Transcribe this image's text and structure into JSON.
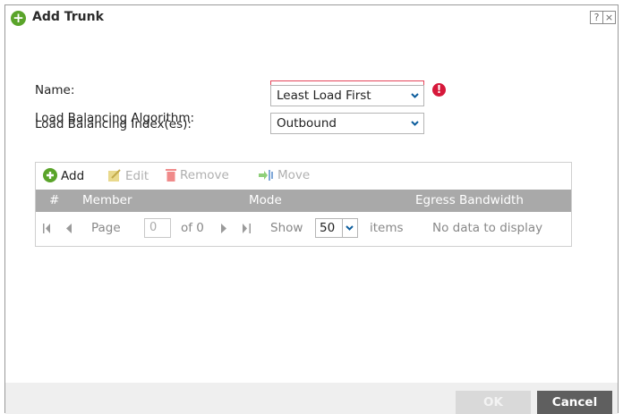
{
  "dialog": {
    "title": "Add Trunk",
    "help_label": "?",
    "close_label": "×"
  },
  "form": {
    "name_label": "Name:",
    "name_value": "",
    "algorithm_label": "Load Balancing Algorithm:",
    "algorithm_value": "Least Load First",
    "index_label": "Load Balancing Index(es):",
    "index_value": "Outbound"
  },
  "toolbar": {
    "add_label": "Add",
    "edit_label": "Edit",
    "remove_label": "Remove",
    "move_label": "Move"
  },
  "table": {
    "columns": [
      "#",
      "Member",
      "Mode",
      "Egress Bandwidth"
    ]
  },
  "pager": {
    "page_label": "Page",
    "page_value": "0",
    "of_label": "of 0",
    "show_label": "Show",
    "show_value": "50",
    "items_label": "items",
    "status": "No data to display"
  },
  "footer": {
    "ok_label": "OK",
    "cancel_label": "Cancel"
  },
  "colors": {
    "accent_green": "#5aa42a",
    "error_red": "#d6183a",
    "header_gray": "#a9a9a9",
    "cancel_bg": "#5f5f5f"
  }
}
